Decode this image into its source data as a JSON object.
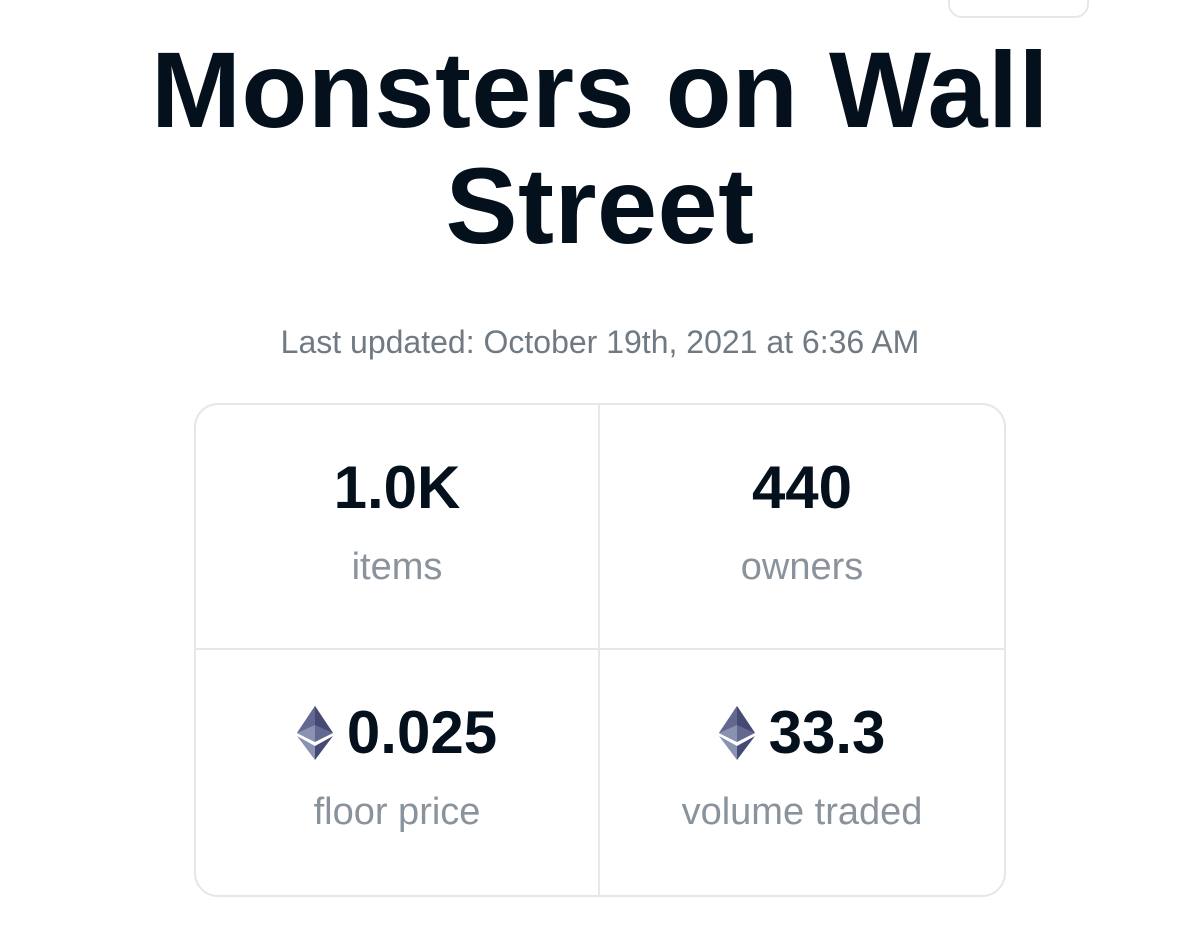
{
  "collection": {
    "title": "Monsters on Wall Street",
    "last_updated": "Last updated: October 19th, 2021 at 6:36 AM"
  },
  "stats": [
    {
      "value": "1.0K",
      "label": "items",
      "icon": null
    },
    {
      "value": "440",
      "label": "owners",
      "icon": null
    },
    {
      "value": "0.025",
      "label": "floor price",
      "icon": "ethereum-icon"
    },
    {
      "value": "33.3",
      "label": "volume traded",
      "icon": "ethereum-icon"
    }
  ],
  "colors": {
    "text_primary": "#04111d",
    "text_secondary": "#707a83",
    "border": "#e5e8eb"
  }
}
